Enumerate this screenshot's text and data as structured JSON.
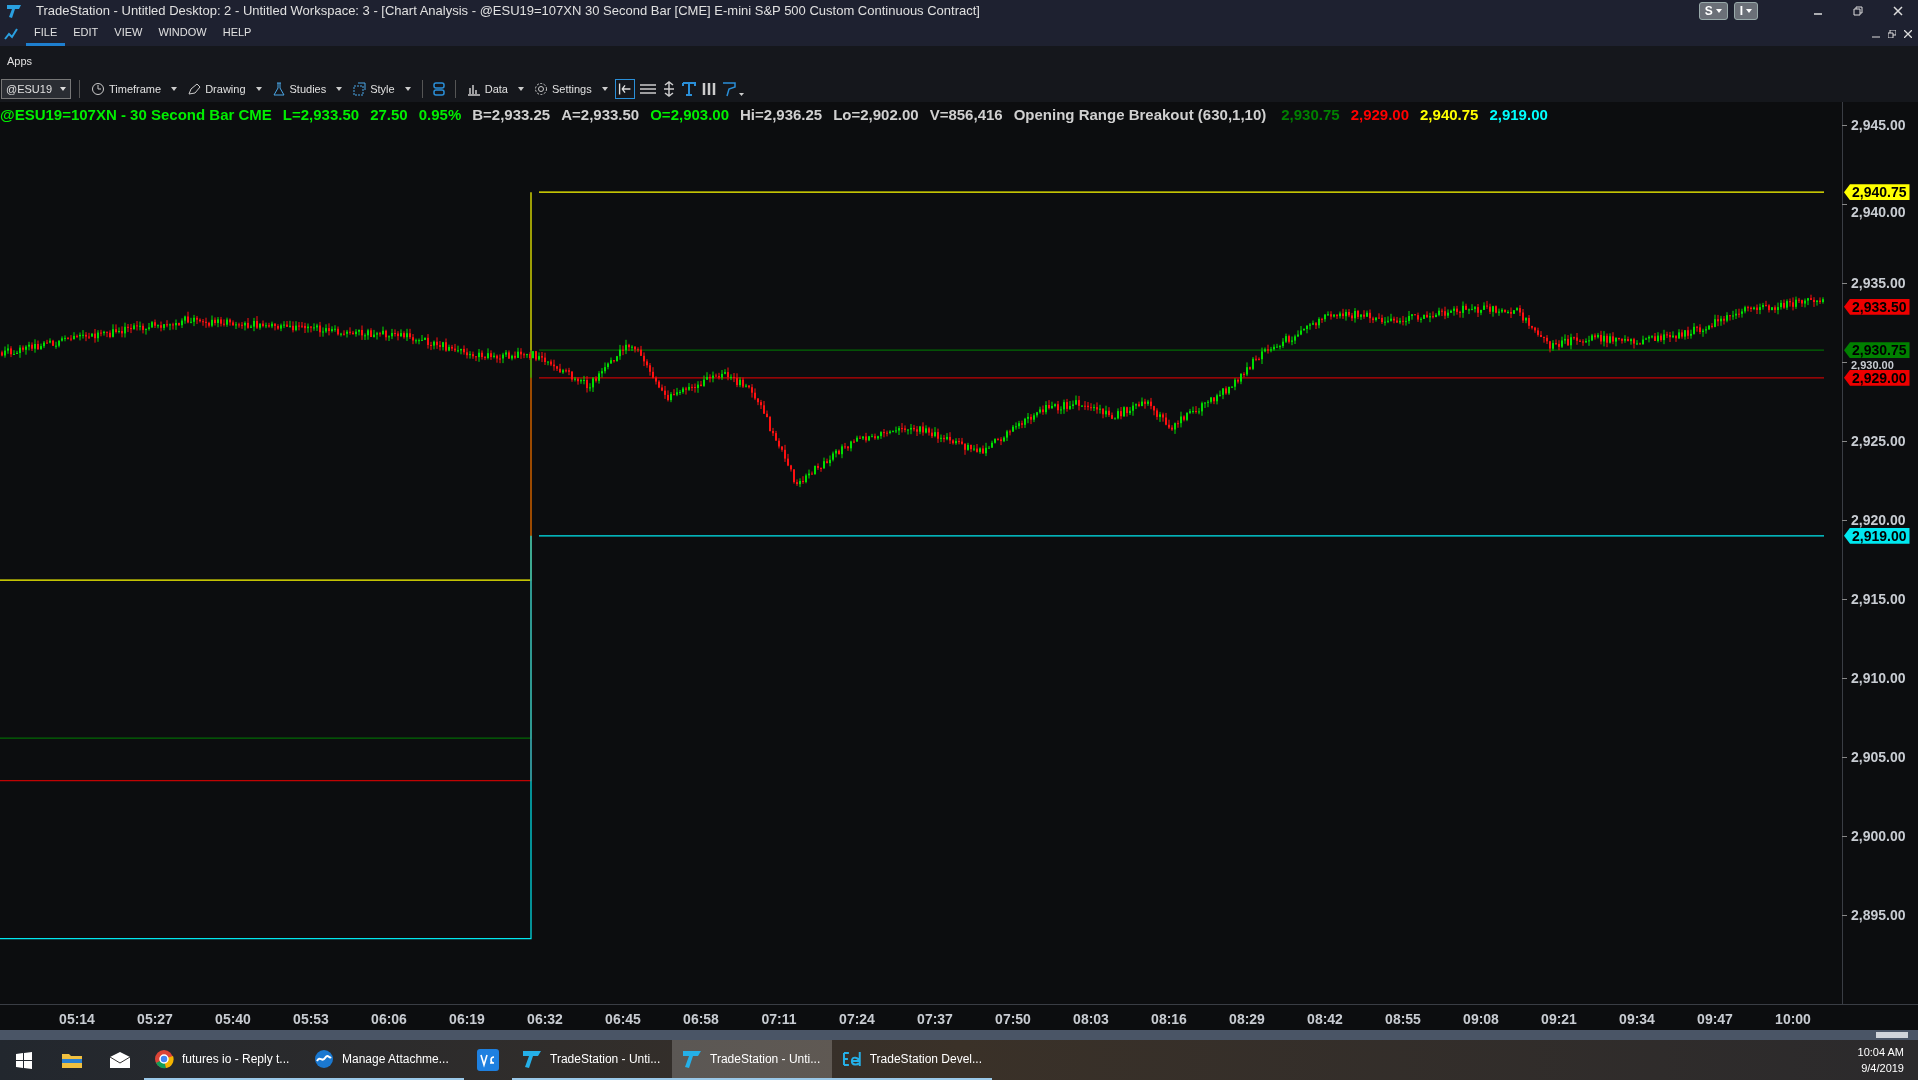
{
  "window": {
    "title": "TradeStation  - Untitled Desktop: 2 - Untitled Workspace:  3 - [Chart Analysis - @ESU19=107XN 30 Second Bar [CME] E-mini S&P 500 Custom Continuous Contract]",
    "top_buttons": [
      "S",
      "I"
    ]
  },
  "menu": [
    {
      "label": "FILE",
      "selected": true
    },
    {
      "label": "EDIT",
      "selected": false
    },
    {
      "label": "VIEW",
      "selected": false
    },
    {
      "label": "WINDOW",
      "selected": false
    },
    {
      "label": "HELP",
      "selected": false
    }
  ],
  "apps_label": "Apps",
  "toolbar": {
    "symbol": "@ESU19",
    "buttons": [
      {
        "kind": "timeframe",
        "label": "Timeframe"
      },
      {
        "kind": "drawing",
        "label": "Drawing"
      },
      {
        "kind": "studies",
        "label": "Studies"
      },
      {
        "kind": "style",
        "label": "Style"
      },
      {
        "kind": "data",
        "label": "Data"
      },
      {
        "kind": "settings",
        "label": "Settings"
      }
    ]
  },
  "chart_header": [
    {
      "text": "@ESU19=107XN - 30 Second Bar  CME",
      "color": "#00ee00"
    },
    {
      "text": "L=2,933.50",
      "color": "#00ee00"
    },
    {
      "text": "27.50",
      "color": "#00ee00"
    },
    {
      "text": "0.95%",
      "color": "#00ee00"
    },
    {
      "text": "B=2,933.25",
      "color": "#d0d0d0"
    },
    {
      "text": "A=2,933.50",
      "color": "#d0d0d0"
    },
    {
      "text": "O=2,903.00",
      "color": "#00ee00"
    },
    {
      "text": "Hi=2,936.25",
      "color": "#d0d0d0"
    },
    {
      "text": "Lo=2,902.00",
      "color": "#d0d0d0"
    },
    {
      "text": "V=856,416",
      "color": "#d0d0d0"
    },
    {
      "text": "Opening Range Breakout (630,1,10)",
      "color": "#d0d0d0"
    },
    {
      "text": "2,930.75",
      "color": "#008000"
    },
    {
      "text": "2,929.00",
      "color": "#ff0000"
    },
    {
      "text": "2,940.75",
      "color": "#ffff00"
    },
    {
      "text": "2,919.00",
      "color": "#00ffff"
    }
  ],
  "price_axis": [
    "2,945.00",
    "2,940.00",
    "2,935.00",
    "2,930.00",
    "2,925.00",
    "2,920.00",
    "2,915.00",
    "2,910.00",
    "2,905.00",
    "2,900.00",
    "2,895.00"
  ],
  "price_tags": [
    {
      "text": "2,940.75",
      "color": "#ffff00"
    },
    {
      "text": "2,933.50",
      "color": "#ee0000"
    },
    {
      "text": "2,930.75",
      "color": "#008000"
    },
    {
      "text": "2,929.00",
      "color": "#ee0000"
    },
    {
      "text": "2,919.00",
      "color": "#00e8f0"
    }
  ],
  "time_axis": [
    "05:14",
    "05:27",
    "05:40",
    "05:53",
    "06:06",
    "06:19",
    "06:32",
    "06:45",
    "06:58",
    "07:11",
    "07:24",
    "07:37",
    "07:50",
    "08:03",
    "08:16",
    "08:29",
    "08:42",
    "08:55",
    "09:08",
    "09:21",
    "09:34",
    "09:47",
    "10:00"
  ],
  "taskbar": [
    {
      "kind": "start"
    },
    {
      "kind": "folder"
    },
    {
      "kind": "mail"
    },
    {
      "kind": "browser",
      "label": "futures io - Reply t...",
      "selected": false
    },
    {
      "kind": "attach",
      "label": "Manage Attachme...",
      "selected": false
    },
    {
      "kind": "ve"
    },
    {
      "kind": "ts",
      "label": "TradeStation  - Unti...",
      "selected": false
    },
    {
      "kind": "ts",
      "label": "TradeStation  - Unti...",
      "selected": true
    },
    {
      "kind": "el",
      "label": "TradeStation Devel...",
      "selected": false
    }
  ],
  "clock": {
    "time": "10:04 AM",
    "date": "9/4/2019"
  }
}
